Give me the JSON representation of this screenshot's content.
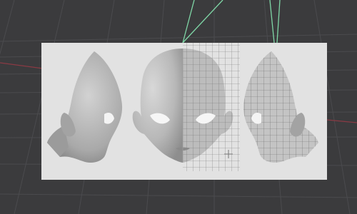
{
  "app": {
    "view_name": "",
    "colors": {
      "viewport_bg": "#3b3b3d",
      "grid_line": "#4a4a4c",
      "axis_x": "#8a3a44",
      "axis_y": "#7fd6a6",
      "reference_plane": "#e2e2e2",
      "head_shade": "#b9b9b9",
      "wireframe": "#5a5a5a"
    },
    "objects": [
      {
        "name": "reference-plane",
        "type": "image plane"
      },
      {
        "name": "head-side-left",
        "type": "mesh view"
      },
      {
        "name": "head-front",
        "type": "mesh view"
      },
      {
        "name": "head-side-right",
        "type": "mesh view"
      }
    ],
    "cursor_icon": "crosshair-icon"
  }
}
